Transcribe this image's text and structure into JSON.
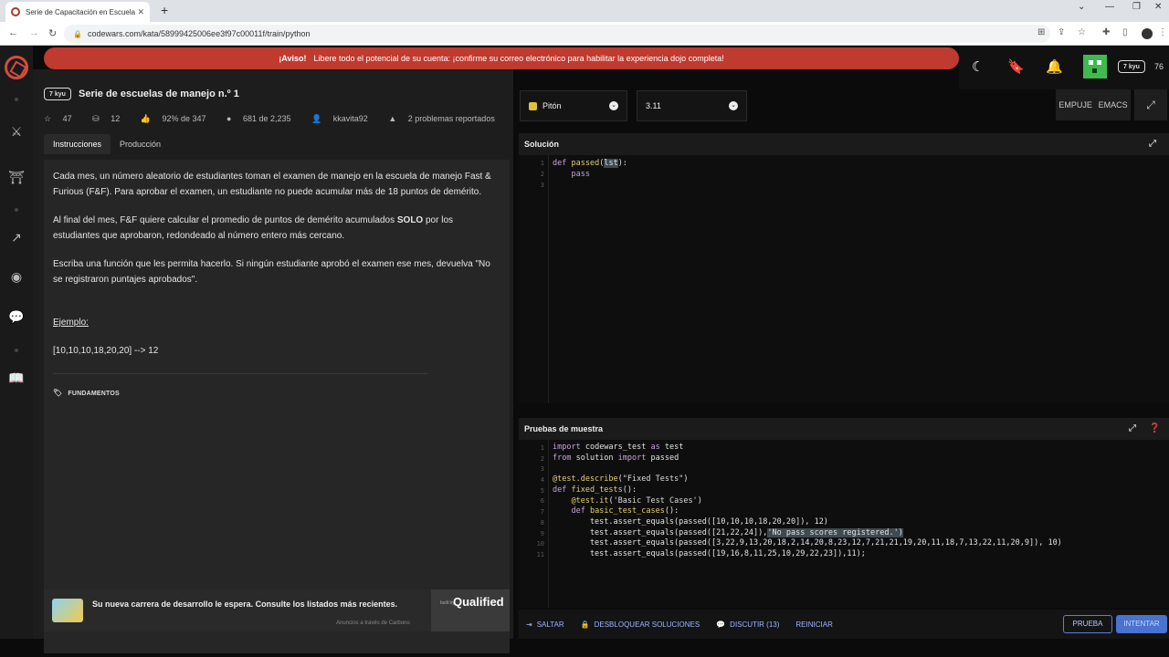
{
  "browser": {
    "tab_title": "Serie de Capacitación en Escuela",
    "url": "codewars.com/kata/58999425006ee3f97c00011f/train/python"
  },
  "banner": {
    "label": "¡Aviso!",
    "text": "Libere todo el potencial de su cuenta: ¡confirme su correo electrónico para habilitar la experiencia dojo completa!"
  },
  "user": {
    "rank": "7 kyu",
    "honor": "76"
  },
  "kata": {
    "rank": "7 kyu",
    "title": "Serie de escuelas de manejo n.º 1",
    "stats": {
      "stars": "47",
      "collections": "12",
      "satisfaction": "92% de 347",
      "completed": "681 de 2,235",
      "author": "kkavita92",
      "issues": "2 problemas reportados"
    },
    "tabs": [
      "Instrucciones",
      "Producción"
    ],
    "description": {
      "p1": "Cada mes, un número aleatorio de estudiantes toman el examen de manejo en la escuela de manejo Fast & Furious (F&F). Para aprobar el examen, un estudiante no puede acumular más de 18 puntos de demérito.",
      "p2_a": "Al final del mes, F&F quiere calcular el promedio de puntos de demérito acumulados ",
      "p2_b": "SOLO",
      "p2_c": " por los estudiantes que aprobaron, redondeado al número entero más cercano.",
      "p3": "Escriba una función que les permita hacerlo. Si ningún estudiante aprobó el examen ese mes, devuelva \"No se registraron puntajes aprobados\".",
      "example_label": "Ejemplo:",
      "example": "[10,10,10,18,20,20] --> 12",
      "tag": "FUNDAMENTOS"
    },
    "ad": {
      "text": "Su nueva carrera de desarrollo le espera. Consulte los listados más recientes.",
      "note": "Anuncios a través de Carbono",
      "brand_small": "built by",
      "brand": "Qualified"
    }
  },
  "editor": {
    "language": "Pitón",
    "version": "3.11",
    "keybindings": [
      "EMPUJE",
      "EMACS"
    ],
    "solution_title": "Solución",
    "tests_title": "Pruebas de muestra",
    "solution_lines": [
      "1",
      "2",
      "3"
    ],
    "test_lines": [
      "1",
      "2",
      "3",
      "4",
      "5",
      "6",
      "7",
      "8",
      "9",
      "10",
      "11"
    ]
  },
  "actions": {
    "skip": "SALTAR",
    "unlock": "DESBLOQUEAR SOLUCIONES",
    "discuss": "DISCUTIR (13)",
    "reset": "REINICIAR",
    "test": "PRUEBA",
    "attempt": "INTENTAR"
  }
}
